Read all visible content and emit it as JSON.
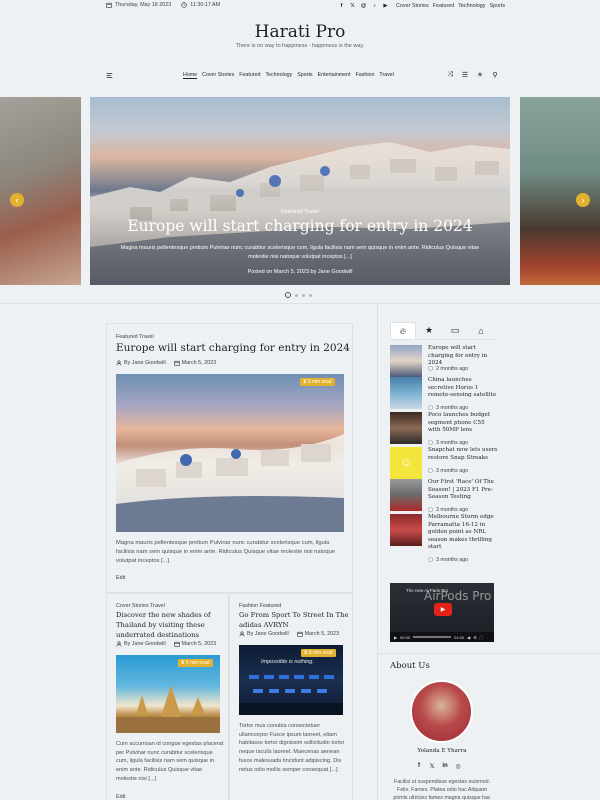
{
  "topbar": {
    "date": "Thursday, May 18 2023",
    "time": "11:30:17 AM",
    "social": [
      "facebook-icon",
      "twitter-icon",
      "threads-icon",
      "tiktok-icon",
      "youtube-icon"
    ],
    "links": [
      "Cover Stories",
      "Featured",
      "Technology",
      "Sports"
    ]
  },
  "site": {
    "title": "Harati Pro",
    "tagline": "There is no way to happiness - happiness is the way."
  },
  "nav": {
    "items": [
      "Home",
      "Cover Stories",
      "Featured",
      "Technology",
      "Sports",
      "Entertainment",
      "Fashion",
      "Travel"
    ],
    "active": "Home"
  },
  "slider": {
    "category": "Featured Travel",
    "title": "Europe will start charging for entry in 2024",
    "excerpt": "Magna mauris pellentesque pretium Pulvinar nunc curabitur scelerisque cum, ligula facilisis nam sem quisque in enim ante. Ridiculus Quisque vitae molestie nisi natoque volutpat inceptos [...]",
    "meta": "Posted on March 5, 2023 by Jane Goodwill",
    "slides_count": 4,
    "active_slide": 1
  },
  "main_post": {
    "category": "Featured Travel",
    "title": "Europe will start charging for entry in 2024",
    "author": "By Jane Goodwill",
    "date": "March 5, 2023",
    "read_time": "5 min read",
    "excerpt": "Magna mauris pellentesque pretium Pulvinar nunc curabitur scelerisque cum, ligula facilisis nam sem quisque in enim ante. Ridiculus Quisque vitae molestie nisi natoque volutpat inceptos [...]",
    "edit": "Edit"
  },
  "post_left": {
    "category": "Cover Stories Travel",
    "title": "Discover the new shades of Thailand by visiting these underrated destinations",
    "author": "By Jane Goodwill",
    "date": "March 5, 2023",
    "read_time": "5 min read",
    "excerpt": "Cum accumsan id congue egestas placerat per Pulvinar nunc curabitur scelerisque cum, ligula facilisis nam sem quisque in enim ante. Ridiculus Quisque vitae molestie nisi [...]",
    "edit": "Edit"
  },
  "post_right": {
    "category": "Fashion Featured",
    "title": "Go From Sport To Street In The adidas AVRYN",
    "author": "By Jane Goodwill",
    "date": "March 5, 2023",
    "read_time": "5 min read",
    "image_text": "Impossible is nothing.",
    "excerpt": "Tortor mus conubia consectetuer ullamcorper Fusce ipsum laoreet, etiam habitasse tortor dignissim sollicitudin tortor neque iaculis laoreet. Maecenas aenean fusce malesuada tincidunt adipiscing. Dis netus odio mollis semper consequat [...]"
  },
  "sidebar": {
    "tabs": [
      "fire-icon",
      "star-icon",
      "comment-icon",
      "tag-icon"
    ],
    "trending": [
      {
        "title": "Europe will start charging for entry in 2024",
        "date": "2 months ago"
      },
      {
        "title": "China launches secretive Horus 1 remote-sensing satellite",
        "date": "3 months ago"
      },
      {
        "title": "Poco launches budget segment phone C55 with 50MP lens",
        "date": "3 months ago"
      },
      {
        "title": "Snapchat now lets users restore Snap Streaks",
        "date": "3 months ago"
      },
      {
        "title": "Our First 'Race' Of The Season! | 2023 F1 Pre-Season Testing",
        "date": "3 months ago"
      },
      {
        "title": "Melbourne Storm edge Parramatta 16-12 in golden point as NRL season makes thrilling start",
        "date": "3 months ago"
      }
    ],
    "video": {
      "title": "The new AirPods Pro",
      "overlay": "AirPods Pro",
      "time_current": "00:00",
      "time_total": "01:00"
    },
    "about": {
      "heading": "About Us",
      "name": "Yolanda E Yharra",
      "social": [
        "facebook-icon",
        "twitter-icon",
        "linkedin-icon",
        "instagram-icon"
      ],
      "text": "Facilisi ut suspendisse egestas euismod. Felis. Fames. Platea odio hac Aliquam primis ultricies fames magna quisque hac"
    }
  },
  "colors": {
    "accent": "#e2b12f",
    "background": "#eef1f4",
    "text": "#1f2328"
  }
}
